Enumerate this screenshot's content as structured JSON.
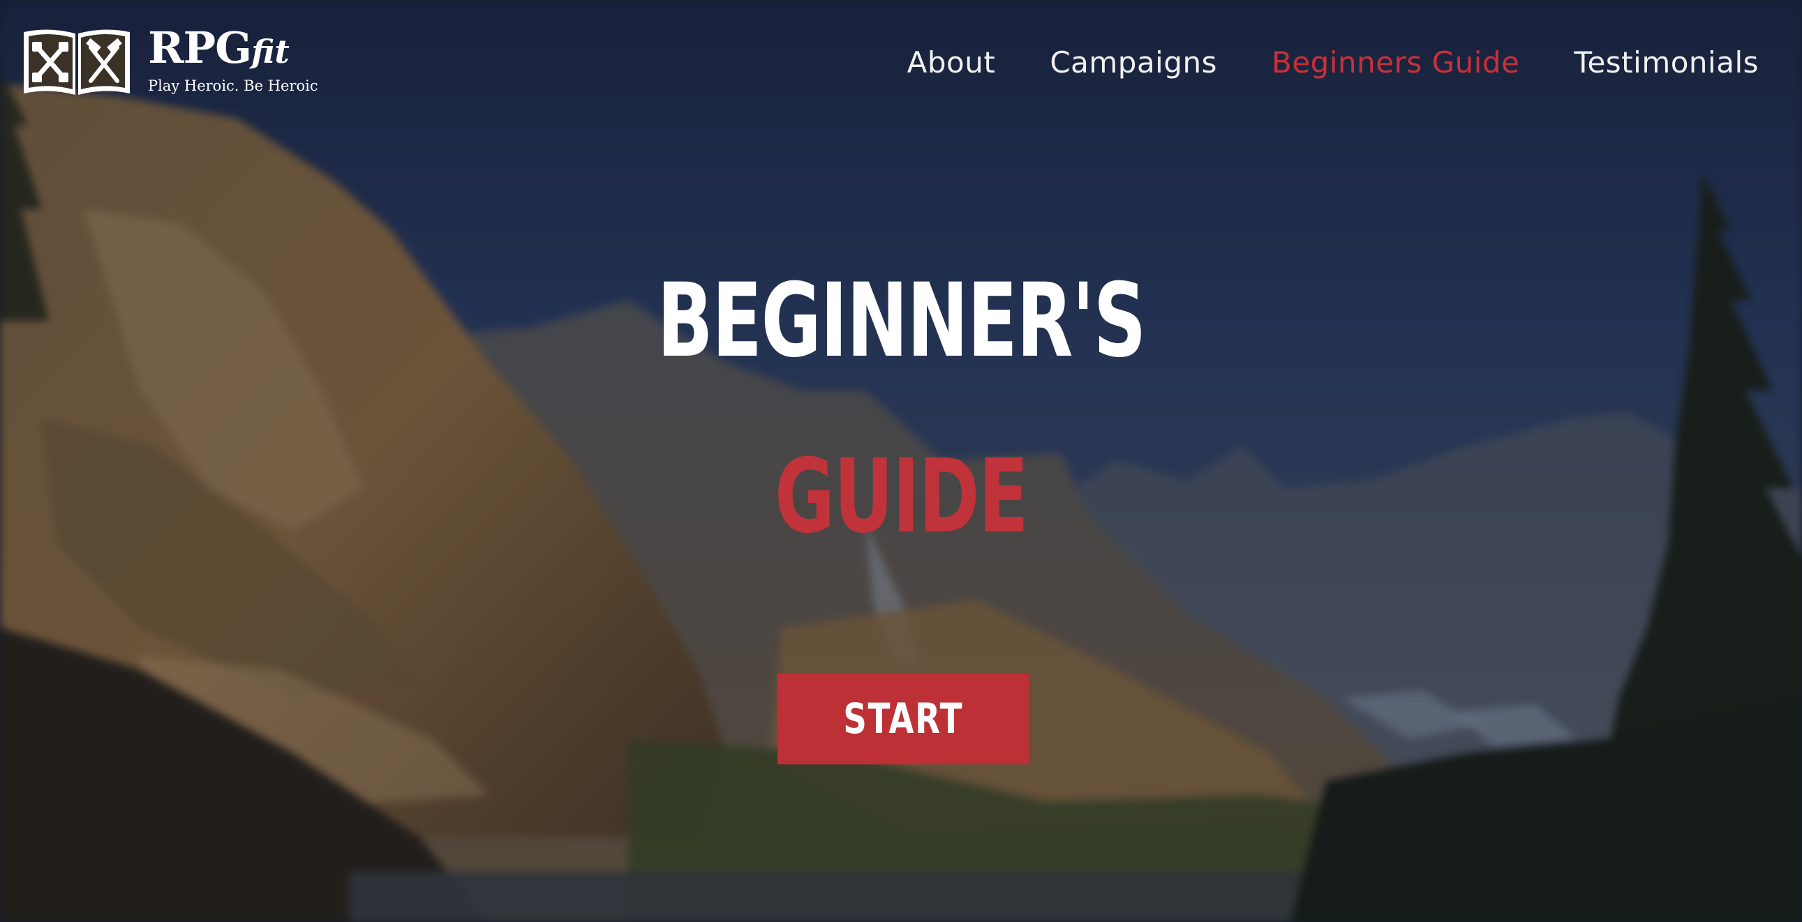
{
  "brand": {
    "name": "RPG",
    "name_suffix": "fit",
    "tagline": "Play Heroic. Be Heroic",
    "logo_icon": "open-book-dumbbell-icon"
  },
  "nav": {
    "items": [
      {
        "label": "About",
        "active": false
      },
      {
        "label": "Campaigns",
        "active": false
      },
      {
        "label": "Beginners Guide",
        "active": true
      },
      {
        "label": "Testimonials",
        "active": false
      }
    ]
  },
  "hero": {
    "title_line1": "BEGINNER'S",
    "title_line2": "GUIDE",
    "cta_label": "START",
    "background": "blurred-mountain-lake-landscape"
  },
  "colors": {
    "accent": "#c0333a",
    "text": "#ffffff",
    "sky_top": "#1d2a4e"
  }
}
